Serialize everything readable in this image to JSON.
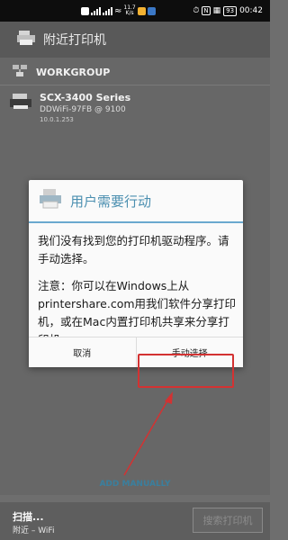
{
  "statusbar": {
    "speed_top": "11.7",
    "speed_bottom": "K/s",
    "battery": "93",
    "time": "00:42"
  },
  "appbar": {
    "title": "附近打印机"
  },
  "list": {
    "group_label": "WORKGROUP",
    "printer": {
      "name": "SCX-3400 Series",
      "network": "DDWiFi-97FB @ 9100",
      "ip": "10.0.1.253"
    },
    "add_manually": "ADD MANUALLY"
  },
  "bottombar": {
    "scan_title": "扫描...",
    "scan_subtitle": "附近 – WiFi",
    "search_button": "搜索打印机"
  },
  "dialog": {
    "title": "用户需要行动",
    "paragraph1": "我们没有找到您的打印机驱动程序。请手动选择。",
    "paragraph2": "注意：你可以在Windows上从printershare.com用我们软件分享打印机，或在Mac内置打印机共享来分享打印机。",
    "cancel_button": "取消",
    "manual_button": "手动选择"
  },
  "colors": {
    "accent": "#4b8fb0",
    "highlight": "#d33232",
    "link": "#3a7f9e"
  }
}
